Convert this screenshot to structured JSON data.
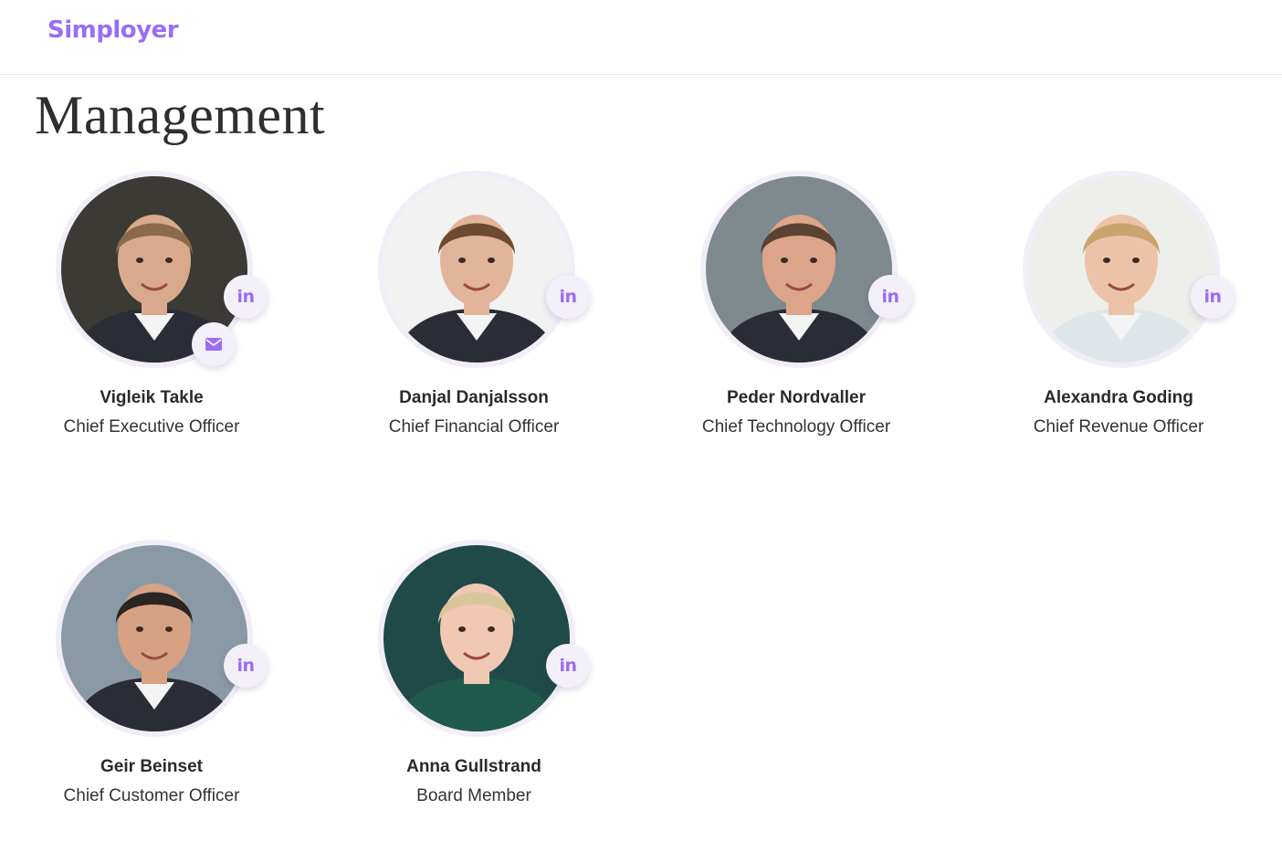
{
  "header": {
    "logo_text": "Simployer",
    "accent_color": "#9b6cf5"
  },
  "page": {
    "title": "Management"
  },
  "people": [
    {
      "name": "Vigleik Takle",
      "role": "Chief Executive Officer",
      "linkedin_label": "in",
      "has_email": true,
      "photo_bg": "#3b3a35",
      "skin": "#d9a98c",
      "hair": "#8a6a4a"
    },
    {
      "name": "Danjal Danjalsson",
      "role": "Chief Financial Officer",
      "linkedin_label": "in",
      "has_email": false,
      "photo_bg": "#f2f2f2",
      "skin": "#e2b49a",
      "hair": "#6b4a30"
    },
    {
      "name": "Peder Nordvaller",
      "role": "Chief Technology Officer",
      "linkedin_label": "in",
      "has_email": false,
      "photo_bg": "#7f8a8f",
      "skin": "#dca58a",
      "hair": "#5a4332"
    },
    {
      "name": "Alexandra Goding",
      "role": "Chief Revenue Officer",
      "linkedin_label": "in",
      "has_email": false,
      "photo_bg": "#eeeeea",
      "skin": "#ecc3a8",
      "hair": "#c9a46e"
    },
    {
      "name": "Geir Beinset",
      "role": "Chief Customer Officer",
      "linkedin_label": "in",
      "has_email": false,
      "photo_bg": "#8a99a6",
      "skin": "#d7a283",
      "hair": "#2a2522"
    },
    {
      "name": "Anna Gullstrand",
      "role": "Board Member",
      "linkedin_label": "in",
      "has_email": false,
      "photo_bg": "#1f4a48",
      "skin": "#f0c8b4",
      "hair": "#d9c59a"
    }
  ]
}
